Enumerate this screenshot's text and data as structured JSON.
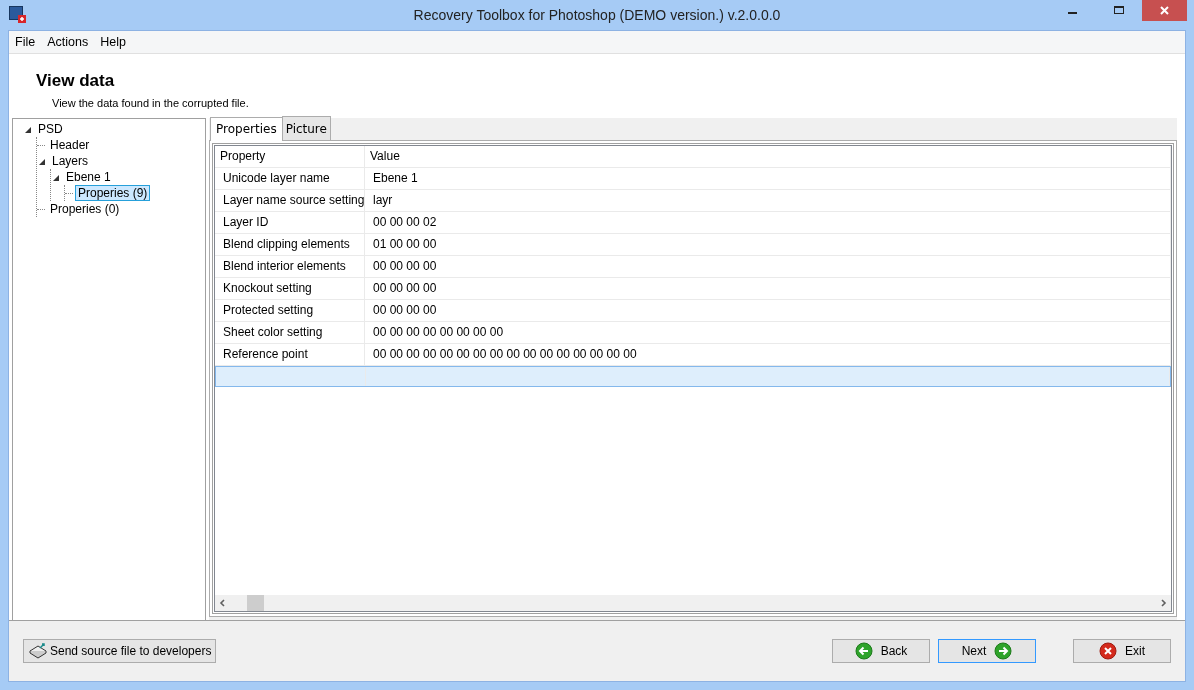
{
  "window": {
    "title": "Recovery Toolbox for Photoshop (DEMO version.) v.2.0.0.0"
  },
  "menu": [
    "File",
    "Actions",
    "Help"
  ],
  "page": {
    "heading": "View data",
    "subtitle": "View the data found in the corrupted file."
  },
  "tree": [
    {
      "label": "PSD",
      "expanded": true,
      "selected": false,
      "children": [
        {
          "label": "Header",
          "selected": false
        },
        {
          "label": "Layers",
          "expanded": true,
          "selected": false,
          "children": [
            {
              "label": "Ebene 1",
              "expanded": true,
              "selected": false,
              "children": [
                {
                  "label": "Properies (9)",
                  "selected": true
                }
              ]
            }
          ]
        },
        {
          "label": "Properies (0)",
          "selected": false
        }
      ]
    }
  ],
  "tabs": [
    {
      "label": "Properties",
      "selected": true
    },
    {
      "label": "Picture",
      "selected": false
    }
  ],
  "table": {
    "columns": [
      "Property",
      "Value"
    ],
    "rows": [
      {
        "property": "Unicode layer name",
        "value": "Ebene 1"
      },
      {
        "property": "Layer name source setting",
        "value": "layr"
      },
      {
        "property": "Layer ID",
        "value": "00 00 00 02"
      },
      {
        "property": "Blend clipping elements",
        "value": "01 00 00 00"
      },
      {
        "property": "Blend interior elements",
        "value": "00 00 00 00"
      },
      {
        "property": "Knockout setting",
        "value": "00 00 00 00"
      },
      {
        "property": "Protected setting",
        "value": "00 00 00 00"
      },
      {
        "property": "Sheet color setting",
        "value": "00 00 00 00 00 00 00 00"
      },
      {
        "property": "Reference point",
        "value": "00 00 00 00 00 00 00 00 00 00 00 00 00 00 00 00"
      }
    ],
    "new_row": {
      "selected": true
    }
  },
  "footer": {
    "send_button": "Send source file to developers",
    "nav_buttons": [
      {
        "label": "Back",
        "kind": "back",
        "focused": false
      },
      {
        "label": "Next",
        "kind": "next",
        "focused": true
      },
      {
        "label": "Exit",
        "kind": "exit",
        "focused": false
      }
    ]
  }
}
